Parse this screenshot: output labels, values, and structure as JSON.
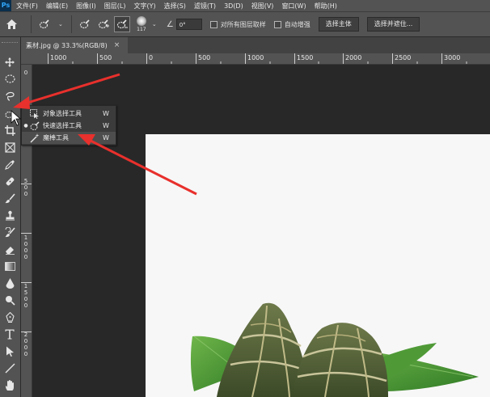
{
  "colors": {
    "ui_panel": "#535353",
    "canvas_bg": "#282828",
    "photo_bg": "#f7f7f7",
    "annotation_arrow": "#e8302c",
    "ps_blue": "#31a8ff"
  },
  "menubar": {
    "logo": "Ps",
    "items": [
      "文件(F)",
      "编辑(E)",
      "图像(I)",
      "图层(L)",
      "文字(Y)",
      "选择(S)",
      "滤镜(T)",
      "3D(D)",
      "视图(V)",
      "窗口(W)",
      "帮助(H)"
    ]
  },
  "options": {
    "brush_size": "117",
    "angle": "0°",
    "sample_all_layers": "对所有图层取样",
    "auto_enhance": "自动增强",
    "select_subject": "选择主体",
    "select_mask": "选择并遮住..."
  },
  "document": {
    "tab_label": "素材.jpg @ 33.3%(RGB/8)",
    "close_glyph": "×"
  },
  "ruler": {
    "top_labels": [
      "1000",
      "500",
      "0",
      "500",
      "1000",
      "1500",
      "2000",
      "2500",
      "3000"
    ],
    "left_labels": [
      "0",
      "5\n0\n0",
      "1\n0\n0\n0",
      "1\n5\n0\n0",
      "2\n0\n0\n0"
    ]
  },
  "flyout": {
    "items": [
      {
        "label": "对象选择工具",
        "key": "W",
        "icon": "object-selection-icon"
      },
      {
        "label": "快速选择工具",
        "key": "W",
        "icon": "quick-selection-icon"
      },
      {
        "label": "魔棒工具",
        "key": "W",
        "icon": "magic-wand-icon"
      }
    ]
  },
  "toolbar": {
    "tools": [
      "move-icon",
      "marquee-icon",
      "lasso-icon",
      "quick-selection-icon",
      "crop-icon",
      "frame-icon",
      "eyedropper-icon",
      "healing-brush-icon",
      "brush-icon",
      "clone-stamp-icon",
      "history-brush-icon",
      "eraser-icon",
      "gradient-icon",
      "blur-icon",
      "dodge-icon",
      "pen-icon",
      "type-icon",
      "path-selection-icon",
      "line-icon",
      "hand-icon"
    ]
  }
}
